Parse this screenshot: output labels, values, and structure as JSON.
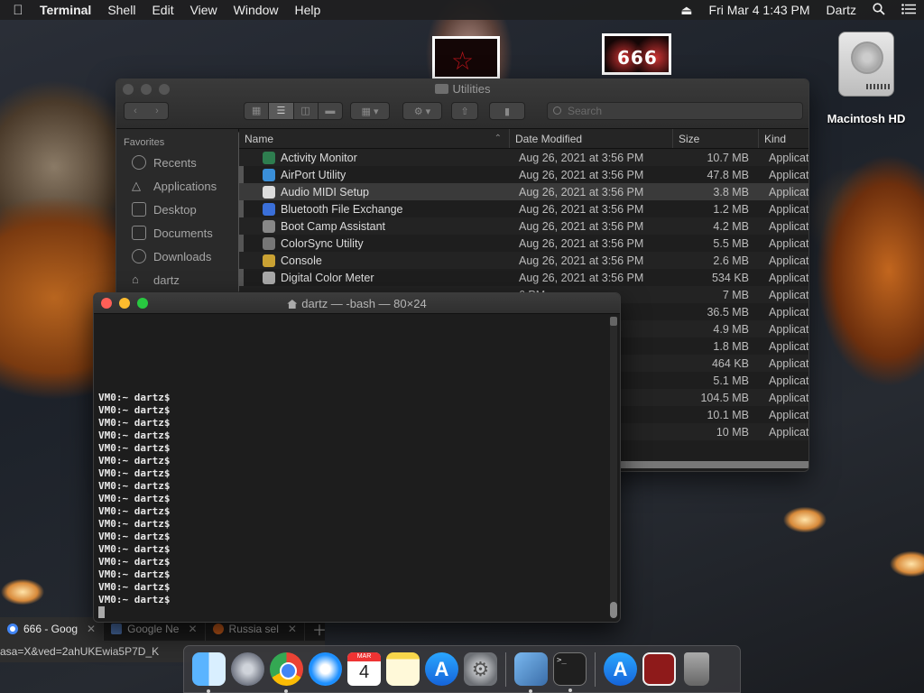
{
  "menubar": {
    "app_name": "Terminal",
    "items": [
      "Shell",
      "Edit",
      "View",
      "Window",
      "Help"
    ],
    "clock": "Fri Mar 4  1:43 PM",
    "user": "Dartz"
  },
  "desktop": {
    "drive_label": "Macintosh HD",
    "thumb2_text": "666"
  },
  "finder": {
    "title": "Utilities",
    "search_placeholder": "Search",
    "sidebar": {
      "section": "Favorites",
      "items": [
        "Recents",
        "Applications",
        "Desktop",
        "Documents",
        "Downloads",
        "dartz"
      ]
    },
    "columns": {
      "name": "Name",
      "date": "Date Modified",
      "size": "Size",
      "kind": "Kind"
    },
    "rows": [
      {
        "name": "Activity Monitor",
        "date": "Aug 26, 2021 at 3:56 PM",
        "size": "10.7 MB",
        "kind": "Applicat"
      },
      {
        "name": "AirPort Utility",
        "date": "Aug 26, 2021 at 3:56 PM",
        "size": "47.8 MB",
        "kind": "Applicat"
      },
      {
        "name": "Audio MIDI Setup",
        "date": "Aug 26, 2021 at 3:56 PM",
        "size": "3.8 MB",
        "kind": "Applicat"
      },
      {
        "name": "Bluetooth File Exchange",
        "date": "Aug 26, 2021 at 3:56 PM",
        "size": "1.2 MB",
        "kind": "Applicat"
      },
      {
        "name": "Boot Camp Assistant",
        "date": "Aug 26, 2021 at 3:56 PM",
        "size": "4.2 MB",
        "kind": "Applicat"
      },
      {
        "name": "ColorSync Utility",
        "date": "Aug 26, 2021 at 3:56 PM",
        "size": "5.5 MB",
        "kind": "Applicat"
      },
      {
        "name": "Console",
        "date": "Aug 26, 2021 at 3:56 PM",
        "size": "2.6 MB",
        "kind": "Applicat"
      },
      {
        "name": "Digital Color Meter",
        "date": "Aug 26, 2021 at 3:56 PM",
        "size": "534 KB",
        "kind": "Applicat"
      },
      {
        "name": "",
        "date": "6 PM",
        "size": "7 MB",
        "kind": "Applicat"
      },
      {
        "name": "",
        "date": "6 PM",
        "size": "36.5 MB",
        "kind": "Applicat"
      },
      {
        "name": "",
        "date": "6 PM",
        "size": "4.9 MB",
        "kind": "Applicat"
      },
      {
        "name": "",
        "date": "6 PM",
        "size": "1.8 MB",
        "kind": "Applicat"
      },
      {
        "name": "",
        "date": "6 PM",
        "size": "464 KB",
        "kind": "Applicat"
      },
      {
        "name": "",
        "date": "6 PM",
        "size": "5.1 MB",
        "kind": "Applicat"
      },
      {
        "name": "",
        "date": "6 PM",
        "size": "104.5 MB",
        "kind": "Applicat"
      },
      {
        "name": "",
        "date": "6 PM",
        "size": "10.1 MB",
        "kind": "Applicat"
      },
      {
        "name": "",
        "date": "6 PM",
        "size": "10 MB",
        "kind": "Applicat"
      }
    ],
    "selected_row": "Audio MIDI Setup"
  },
  "terminal": {
    "title": "dartz — -bash — 80×24",
    "prompt": "VM0:~ dartz$",
    "prompt_count": 17
  },
  "browser": {
    "tabs": [
      "666 - Goog",
      "Google Ne",
      "Russia sel"
    ],
    "url": "asa=X&ved=2ahUKEwia5P7D_K"
  },
  "dock": {
    "calendar_month": "MAR",
    "calendar_day": "4",
    "terminal_glyph": ">_",
    "items": [
      "finder-icon",
      "launchpad-icon",
      "chrome-icon",
      "safari-icon",
      "calendar-icon",
      "notes-icon",
      "app-store-icon",
      "system-preferences-icon",
      "preview-icon",
      "terminal-icon",
      "app-store-downloads-icon",
      "image-icon",
      "trash-icon"
    ]
  },
  "colors": {
    "close": "#fe5f57",
    "minimize": "#febc2e",
    "zoom": "#28c840"
  }
}
